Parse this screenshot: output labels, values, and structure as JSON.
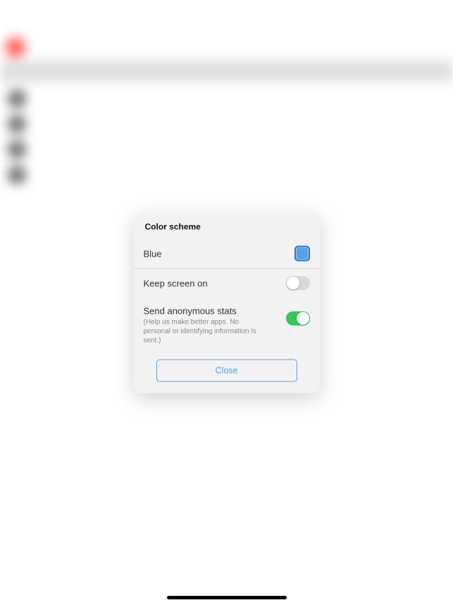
{
  "modal": {
    "section_title": "Color scheme",
    "color_row": {
      "label": "Blue"
    },
    "keep_screen_row": {
      "label": "Keep screen on",
      "on": false
    },
    "stats_row": {
      "label": "Send anonymous stats",
      "sub": "(Help us make better apps. No personal or identifying information is sent.)",
      "on": true
    },
    "close_label": "Close"
  }
}
